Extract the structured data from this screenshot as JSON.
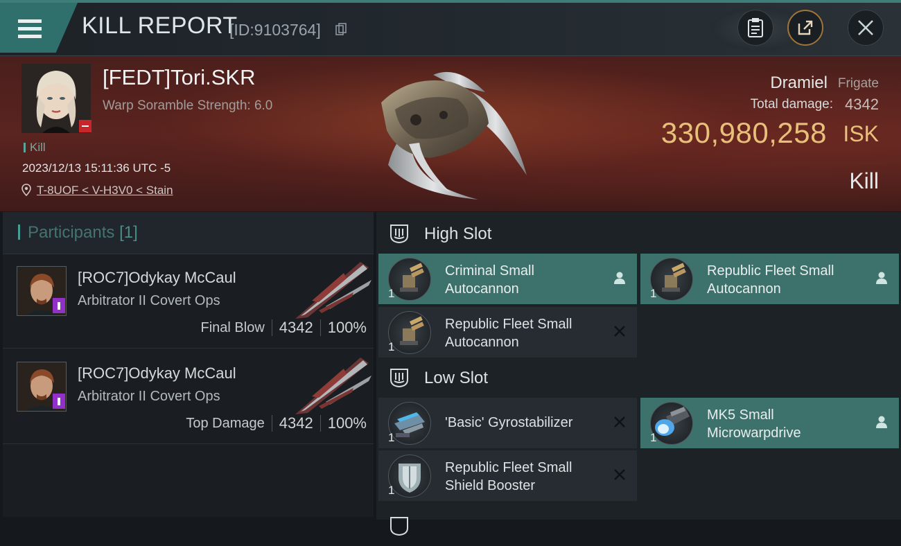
{
  "header": {
    "title": "KILL REPORT",
    "kill_id": "[ID:9103764]"
  },
  "victim": {
    "name": "[FEDT]Tori.SKR",
    "warp_scramble": "Warp Soramble Strength: 6.0",
    "kill_tag": "Kill",
    "timestamp": "2023/12/13 15:11:36 UTC -5",
    "location": "T-8UOF < V-H3V0 < Stain",
    "ship": "Dramiel",
    "ship_class": "Frigate",
    "total_damage_label": "Total damage:",
    "total_damage": "4342",
    "isk_value": "330,980,258",
    "isk_unit": "ISK",
    "result": "Kill"
  },
  "participants": {
    "title": "Participants",
    "count": "[1]",
    "rows": [
      {
        "name": "[ROC7]Odykay McCaul",
        "ship": "Arbitrator II Covert Ops",
        "label": "Final Blow",
        "damage": "4342",
        "percent": "100%"
      },
      {
        "name": "[ROC7]Odykay McCaul",
        "ship": "Arbitrator II Covert Ops",
        "label": "Top Damage",
        "damage": "4342",
        "percent": "100%"
      }
    ]
  },
  "fitting": {
    "high_slot": {
      "title": "High Slot",
      "modules": [
        {
          "name_l1": "Criminal Small",
          "name_l2": "Autocannon",
          "qty": "1",
          "status": "dropped"
        },
        {
          "name_l1": "Republic Fleet Small",
          "name_l2": "Autocannon",
          "qty": "1",
          "status": "dropped"
        },
        {
          "name_l1": "Republic Fleet Small",
          "name_l2": "Autocannon",
          "qty": "1",
          "status": "destroyed"
        }
      ]
    },
    "low_slot": {
      "title": "Low Slot",
      "modules": [
        {
          "name_l1": "'Basic' Gyrostabilizer",
          "name_l2": "",
          "qty": "1",
          "status": "destroyed"
        },
        {
          "name_l1": "MK5 Small",
          "name_l2": "Microwarpdrive",
          "qty": "1",
          "status": "dropped"
        },
        {
          "name_l1": "Republic Fleet Small",
          "name_l2": "Shield Booster",
          "qty": "1",
          "status": "destroyed"
        }
      ]
    }
  },
  "colors": {
    "accent": "#3e7d78",
    "isk": "#e8c07a",
    "dropped_bg": "#3d726c",
    "destroyed_bg": "#262c31"
  }
}
